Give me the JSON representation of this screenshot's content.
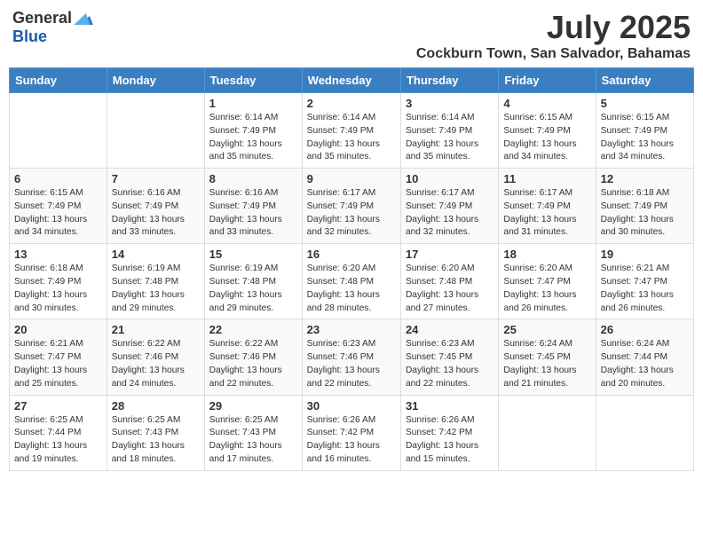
{
  "logo": {
    "general": "General",
    "blue": "Blue"
  },
  "title": "July 2025",
  "location": "Cockburn Town, San Salvador, Bahamas",
  "days_of_week": [
    "Sunday",
    "Monday",
    "Tuesday",
    "Wednesday",
    "Thursday",
    "Friday",
    "Saturday"
  ],
  "weeks": [
    [
      {
        "day": "",
        "detail": ""
      },
      {
        "day": "",
        "detail": ""
      },
      {
        "day": "1",
        "detail": "Sunrise: 6:14 AM\nSunset: 7:49 PM\nDaylight: 13 hours and 35 minutes."
      },
      {
        "day": "2",
        "detail": "Sunrise: 6:14 AM\nSunset: 7:49 PM\nDaylight: 13 hours and 35 minutes."
      },
      {
        "day": "3",
        "detail": "Sunrise: 6:14 AM\nSunset: 7:49 PM\nDaylight: 13 hours and 35 minutes."
      },
      {
        "day": "4",
        "detail": "Sunrise: 6:15 AM\nSunset: 7:49 PM\nDaylight: 13 hours and 34 minutes."
      },
      {
        "day": "5",
        "detail": "Sunrise: 6:15 AM\nSunset: 7:49 PM\nDaylight: 13 hours and 34 minutes."
      }
    ],
    [
      {
        "day": "6",
        "detail": "Sunrise: 6:15 AM\nSunset: 7:49 PM\nDaylight: 13 hours and 34 minutes."
      },
      {
        "day": "7",
        "detail": "Sunrise: 6:16 AM\nSunset: 7:49 PM\nDaylight: 13 hours and 33 minutes."
      },
      {
        "day": "8",
        "detail": "Sunrise: 6:16 AM\nSunset: 7:49 PM\nDaylight: 13 hours and 33 minutes."
      },
      {
        "day": "9",
        "detail": "Sunrise: 6:17 AM\nSunset: 7:49 PM\nDaylight: 13 hours and 32 minutes."
      },
      {
        "day": "10",
        "detail": "Sunrise: 6:17 AM\nSunset: 7:49 PM\nDaylight: 13 hours and 32 minutes."
      },
      {
        "day": "11",
        "detail": "Sunrise: 6:17 AM\nSunset: 7:49 PM\nDaylight: 13 hours and 31 minutes."
      },
      {
        "day": "12",
        "detail": "Sunrise: 6:18 AM\nSunset: 7:49 PM\nDaylight: 13 hours and 30 minutes."
      }
    ],
    [
      {
        "day": "13",
        "detail": "Sunrise: 6:18 AM\nSunset: 7:49 PM\nDaylight: 13 hours and 30 minutes."
      },
      {
        "day": "14",
        "detail": "Sunrise: 6:19 AM\nSunset: 7:48 PM\nDaylight: 13 hours and 29 minutes."
      },
      {
        "day": "15",
        "detail": "Sunrise: 6:19 AM\nSunset: 7:48 PM\nDaylight: 13 hours and 29 minutes."
      },
      {
        "day": "16",
        "detail": "Sunrise: 6:20 AM\nSunset: 7:48 PM\nDaylight: 13 hours and 28 minutes."
      },
      {
        "day": "17",
        "detail": "Sunrise: 6:20 AM\nSunset: 7:48 PM\nDaylight: 13 hours and 27 minutes."
      },
      {
        "day": "18",
        "detail": "Sunrise: 6:20 AM\nSunset: 7:47 PM\nDaylight: 13 hours and 26 minutes."
      },
      {
        "day": "19",
        "detail": "Sunrise: 6:21 AM\nSunset: 7:47 PM\nDaylight: 13 hours and 26 minutes."
      }
    ],
    [
      {
        "day": "20",
        "detail": "Sunrise: 6:21 AM\nSunset: 7:47 PM\nDaylight: 13 hours and 25 minutes."
      },
      {
        "day": "21",
        "detail": "Sunrise: 6:22 AM\nSunset: 7:46 PM\nDaylight: 13 hours and 24 minutes."
      },
      {
        "day": "22",
        "detail": "Sunrise: 6:22 AM\nSunset: 7:46 PM\nDaylight: 13 hours and 22 minutes."
      },
      {
        "day": "23",
        "detail": "Sunrise: 6:23 AM\nSunset: 7:46 PM\nDaylight: 13 hours and 22 minutes."
      },
      {
        "day": "24",
        "detail": "Sunrise: 6:23 AM\nSunset: 7:45 PM\nDaylight: 13 hours and 22 minutes."
      },
      {
        "day": "25",
        "detail": "Sunrise: 6:24 AM\nSunset: 7:45 PM\nDaylight: 13 hours and 21 minutes."
      },
      {
        "day": "26",
        "detail": "Sunrise: 6:24 AM\nSunset: 7:44 PM\nDaylight: 13 hours and 20 minutes."
      }
    ],
    [
      {
        "day": "27",
        "detail": "Sunrise: 6:25 AM\nSunset: 7:44 PM\nDaylight: 13 hours and 19 minutes."
      },
      {
        "day": "28",
        "detail": "Sunrise: 6:25 AM\nSunset: 7:43 PM\nDaylight: 13 hours and 18 minutes."
      },
      {
        "day": "29",
        "detail": "Sunrise: 6:25 AM\nSunset: 7:43 PM\nDaylight: 13 hours and 17 minutes."
      },
      {
        "day": "30",
        "detail": "Sunrise: 6:26 AM\nSunset: 7:42 PM\nDaylight: 13 hours and 16 minutes."
      },
      {
        "day": "31",
        "detail": "Sunrise: 6:26 AM\nSunset: 7:42 PM\nDaylight: 13 hours and 15 minutes."
      },
      {
        "day": "",
        "detail": ""
      },
      {
        "day": "",
        "detail": ""
      }
    ]
  ]
}
